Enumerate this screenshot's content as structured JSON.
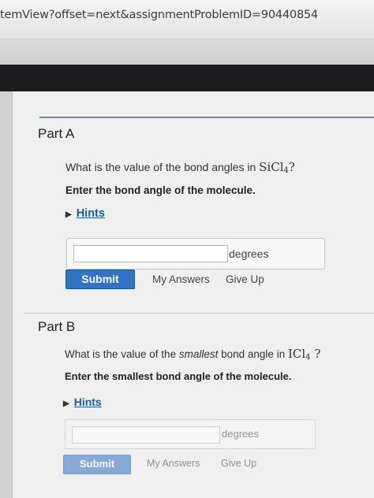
{
  "browser": {
    "url": "temView?offset=next&assignmentProblemID=90440854"
  },
  "partA": {
    "title": "Part A",
    "question": "What is the value of the bond angles in",
    "formula_main": "SiCl",
    "formula_sub": "4",
    "formula_end": "?",
    "instruction": "Enter the bond angle of the molecule.",
    "hints_label": "Hints",
    "input_value": "",
    "unit": "degrees",
    "submit_label": "Submit",
    "my_answers_label": "My Answers",
    "give_up_label": "Give Up"
  },
  "partB": {
    "title": "Part B",
    "question_pre": "What is the value of the",
    "question_em": "smallest",
    "question_post": "bond angle in",
    "formula_main": "ICl",
    "formula_sub": "4",
    "formula_end": "?",
    "instruction": "Enter the smallest bond angle of the molecule.",
    "hints_label": "Hints",
    "input_value": "",
    "unit": "degrees",
    "submit_label": "Submit",
    "my_answers_label": "My Answers",
    "give_up_label": "Give Up"
  },
  "colors": {
    "accent": "#2f73c2",
    "link": "#1f5c99",
    "header_dark": "#1c1c1e"
  },
  "icons": {
    "hints_toggle": "triangle-right-icon"
  }
}
